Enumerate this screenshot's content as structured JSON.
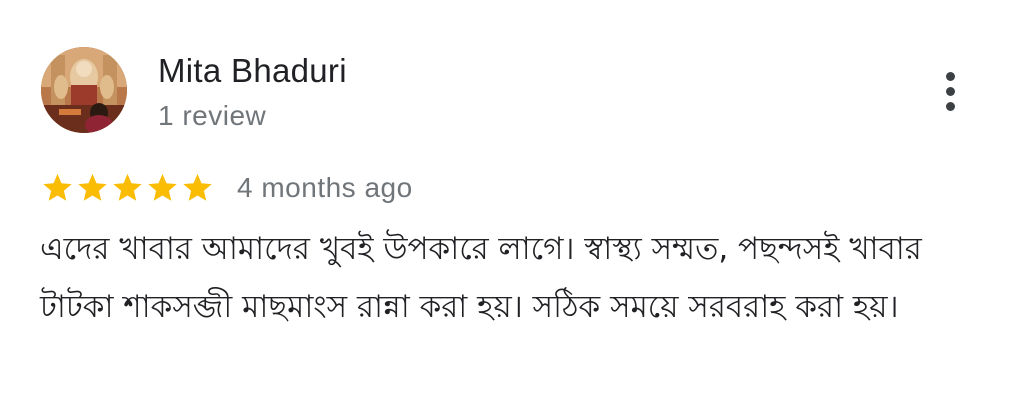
{
  "author": {
    "name": "Mita Bhaduri",
    "review_count": "1 review",
    "avatar_icon": "profile-photo"
  },
  "review": {
    "rating": 5,
    "max_rating": 5,
    "date": "4 months ago",
    "text": "এদের খাবার আমাদের খুবই উপকারে লাগে। স্বাস্থ্য সম্মত, পছন্দসই খাবার টাটকা শাকসব্জী মাছমাংস রান্না করা হয়। সঠিক সময়ে সরবরাহ করা হয়।"
  },
  "menu": {
    "icon": "more-vert-icon"
  },
  "colors": {
    "star": "#fbbc04",
    "name": "#202124",
    "secondary": "#70757a",
    "icon": "#3c4043"
  }
}
